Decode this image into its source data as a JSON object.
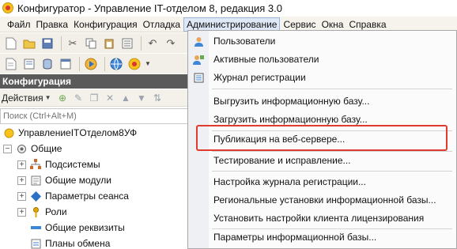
{
  "title": "Конфигуратор - Управление IT-отделом 8, редакция 3.0",
  "menubar": {
    "items": [
      {
        "label": "Файл"
      },
      {
        "label": "Правка"
      },
      {
        "label": "Конфигурация"
      },
      {
        "label": "Отладка"
      },
      {
        "label": "Администрирование"
      },
      {
        "label": "Сервис"
      },
      {
        "label": "Окна"
      },
      {
        "label": "Справка"
      }
    ]
  },
  "panel": {
    "title": "Конфигурация",
    "actions_label": "Действия",
    "search_placeholder": "Поиск (Ctrl+Alt+M)"
  },
  "tree": {
    "root": "УправлениеITОтделом8УФ",
    "common": "Общие",
    "children": [
      "Подсистемы",
      "Общие модули",
      "Параметры сеанса",
      "Роли",
      "Общие реквизиты",
      "Планы обмена"
    ]
  },
  "dropdown": {
    "items": [
      {
        "label": "Пользователи",
        "icon": "users-icon"
      },
      {
        "label": "Активные пользователи",
        "icon": "active-users-icon"
      },
      {
        "label": "Журнал регистрации",
        "icon": "log-icon"
      },
      {
        "label": "Выгрузить информационную базу..."
      },
      {
        "label": "Загрузить информационную базу..."
      },
      {
        "label": "Публикация на веб-сервере..."
      },
      {
        "label": "Тестирование и исправление..."
      },
      {
        "label": "Настройка журнала регистрации..."
      },
      {
        "label": "Региональные установки информационной базы..."
      },
      {
        "label": "Установить настройки клиента лицензирования"
      },
      {
        "label": "Параметры информационной базы..."
      }
    ]
  },
  "colors": {
    "highlight": "#e03b2e",
    "panel_header": "#5a5a5a",
    "active_menu": "#dfe8f7"
  }
}
